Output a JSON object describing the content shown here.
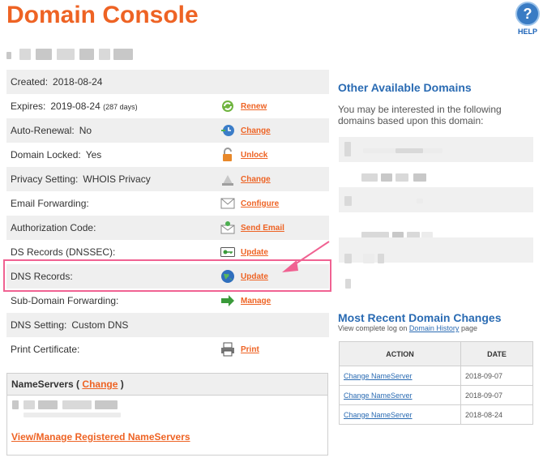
{
  "header": {
    "title": "Domain Console",
    "help_label": "HELP",
    "help_glyph": "?"
  },
  "details": {
    "created": {
      "label": "Created:",
      "value": "2018-08-24"
    },
    "expires": {
      "label": "Expires:",
      "value": "2019-08-24",
      "note": "(287 days)",
      "action": "Renew",
      "icon": "renew-icon"
    },
    "auto_renewal": {
      "label": "Auto-Renewal:",
      "value": "No",
      "action": "Change",
      "icon": "clock-icon"
    },
    "domain_locked": {
      "label": "Domain Locked:",
      "value": "Yes",
      "action": "Unlock",
      "icon": "lock-icon"
    },
    "privacy": {
      "label": "Privacy Setting:",
      "value": "WHOIS Privacy",
      "action": "Change",
      "icon": "privacy-icon"
    },
    "email_forwarding": {
      "label": "Email Forwarding:",
      "action": "Configure",
      "icon": "envelope-icon"
    },
    "auth_code": {
      "label": "Authorization Code:",
      "action": "Send Email",
      "icon": "send-email-icon"
    },
    "ds_records": {
      "label": "DS Records (DNSSEC):",
      "action": "Update",
      "icon": "key-icon"
    },
    "dns_records": {
      "label": "DNS Records:",
      "action": "Update",
      "icon": "globe-icon"
    },
    "subdomain": {
      "label": "Sub-Domain Forwarding:",
      "action": "Manage",
      "icon": "arrow-icon"
    },
    "dns_setting": {
      "label": "DNS Setting:",
      "value": "Custom DNS"
    },
    "print_cert": {
      "label": "Print Certificate:",
      "action": "Print",
      "icon": "printer-icon"
    }
  },
  "nameservers": {
    "title_prefix": "NameServers (",
    "change_label": "Change",
    "title_suffix": ")",
    "manage_link": "View/Manage Registered NameServers"
  },
  "sidebar": {
    "other_title": "Other Available Domains",
    "other_desc": "You may be interested in the following domains based upon this domain:",
    "recent_title": "Most Recent Domain Changes",
    "log_prefix": "View complete log on",
    "log_link": "Domain History",
    "log_suffix": "page"
  },
  "changes_table": {
    "headers": [
      "ACTION",
      "DATE"
    ],
    "rows": [
      {
        "action": "Change NameServer",
        "date": "2018-09-07"
      },
      {
        "action": "Change NameServer",
        "date": "2018-09-07"
      },
      {
        "action": "Change NameServer",
        "date": "2018-08-24"
      }
    ]
  },
  "colors": {
    "brand_orange": "#ee6324",
    "link_blue": "#2a6bb3",
    "highlight_pink": "#f06292"
  }
}
